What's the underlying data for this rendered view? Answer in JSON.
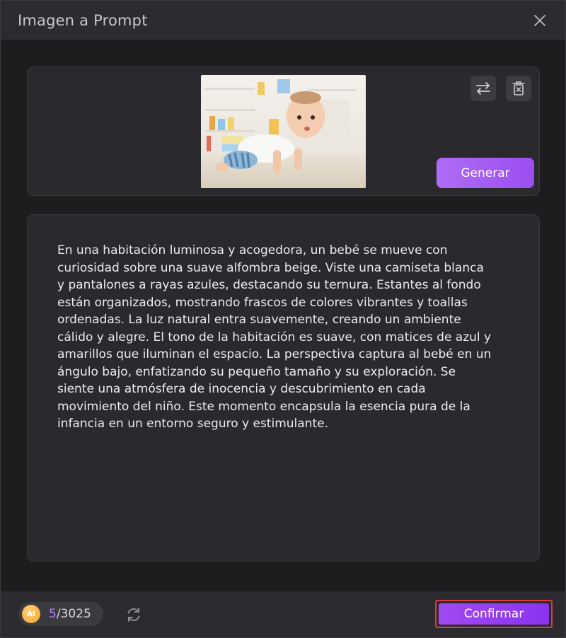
{
  "window": {
    "title": "Imagen a Prompt"
  },
  "image_panel": {
    "generate_label": "Generar",
    "thumbnail_icon": "baby-crawling-photo",
    "swap_icon": "swap-arrows-icon",
    "delete_icon": "trash-icon"
  },
  "prompt": {
    "text": "En una habitación luminosa y acogedora, un bebé se mueve con\ncuriosidad sobre una suave alfombra beige. Viste una camiseta blanca\ny pantalones a rayas azules, destacando su ternura. Estantes al fondo\nestán organizados, mostrando frascos de colores vibrantes y toallas\nordenadas. La luz natural entra suavemente, creando un ambiente\ncálido y alegre. El tono de la habitación es suave, con matices de azul y\namarillos que iluminan el espacio. La perspectiva captura al bebé en un\nángulo bajo, enfatizando su pequeño tamaño y su exploración. Se\nsiente una atmósfera de inocencia y descubrimiento en cada\nmovimiento del niño. Este momento encapsula la esencia pura de la\ninfancia en un entorno seguro y estimulante."
  },
  "footer": {
    "ai_badge": "AI",
    "credits_used": "5",
    "credits_total": "/3025",
    "confirm_label": "Confirmar"
  },
  "colors": {
    "accent": "#9a4ff0",
    "highlight_border": "#e0393f",
    "background": "#1d1d20"
  }
}
